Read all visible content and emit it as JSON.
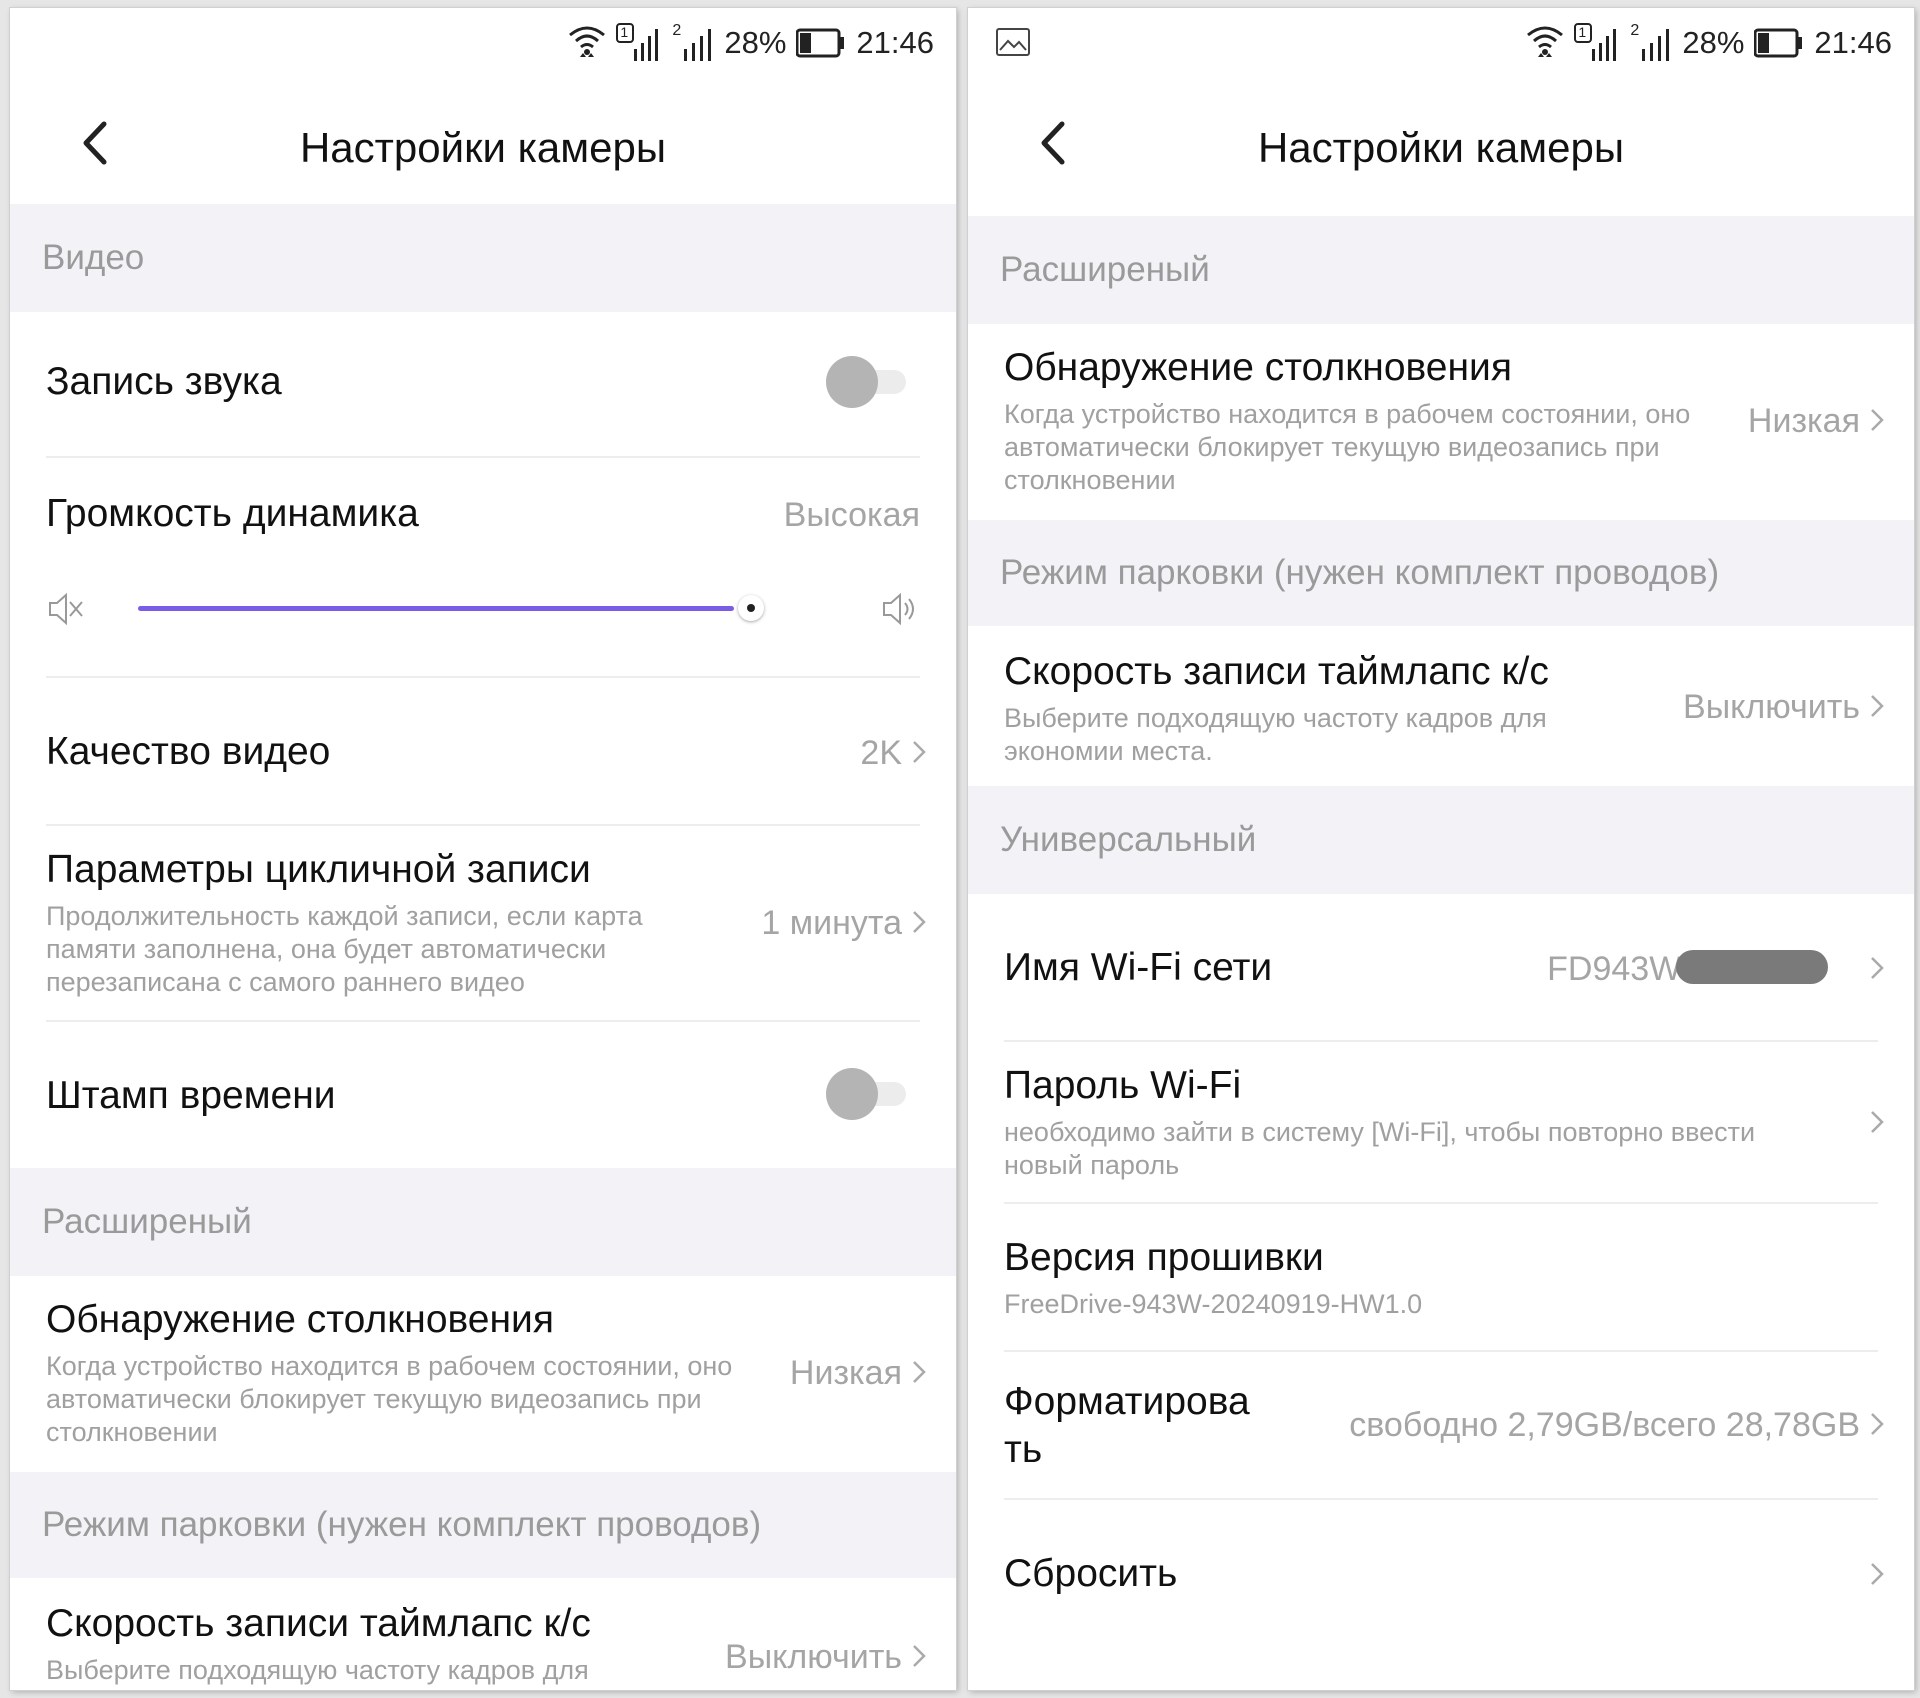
{
  "status_bar": {
    "sim1_label": "1",
    "sim2_label": "2",
    "battery_percent": "28%",
    "battery_level": 0.28,
    "time": "21:46"
  },
  "left": {
    "title": "Настройки камеры",
    "sections": {
      "video": "Видео",
      "advanced": "Расширеный",
      "parking": "Режим парковки (нужен комплект проводов)"
    },
    "sound_recording": {
      "label": "Запись звука",
      "enabled": false
    },
    "speaker_volume": {
      "label": "Громкость динамика",
      "value": "Высокая",
      "slider_level": 1.0
    },
    "video_quality": {
      "label": "Качество видео",
      "value": "2K"
    },
    "loop_recording": {
      "label": "Параметры цикличной записи",
      "desc": "Продолжительность каждой записи, если карта памяти заполнена, она будет автоматически перезаписана с самого раннего видео",
      "value": "1 минута"
    },
    "timestamp": {
      "label": "Штамп времени",
      "enabled": false
    },
    "collision": {
      "label": "Обнаружение столкновения",
      "desc": "Когда устройство находится в рабочем состоянии, оно автоматически блокирует текущую видеозапись при столкновении",
      "value": "Низкая"
    },
    "timelapse": {
      "label": "Скорость записи таймлапс к/с",
      "desc": "Выберите подходящую частоту кадров для",
      "value": "Выключить"
    }
  },
  "right": {
    "title": "Настройки камеры",
    "sections": {
      "advanced": "Расширеный",
      "parking": "Режим парковки (нужен комплект проводов)",
      "universal": "Универсальный"
    },
    "collision": {
      "label": "Обнаружение столкновения",
      "desc": "Когда устройство находится в рабочем состоянии, оно автоматически блокирует текущую видеозапись при столкновении",
      "value": "Низкая"
    },
    "timelapse": {
      "label": "Скорость записи таймлапс к/с",
      "desc": "Выберите подходящую частоту кадров для экономии места.",
      "value": "Выключить"
    },
    "wifi_name": {
      "label": "Имя Wi-Fi сети",
      "value": "FD943W-"
    },
    "wifi_password": {
      "label": "Пароль Wi-Fi",
      "desc": "необходимо зайти в систему [Wi-Fi], чтобы повторно ввести новый пароль"
    },
    "firmware": {
      "label": "Версия прошивки",
      "value": "FreeDrive-943W-20240919-HW1.0"
    },
    "format": {
      "label": "Форматирова ть",
      "value": "свободно 2,79GB/всего 28,78GB"
    },
    "reset": {
      "label": "Сбросить"
    }
  },
  "colors": {
    "accent": "#7b5ce6",
    "section_bg": "#f3f3f7",
    "muted_text": "#a0a0a0",
    "toggle_off": "#b4b4b4"
  },
  "icons": [
    "wifi-icon",
    "signal-icon",
    "battery-icon",
    "back-arrow-icon",
    "chevron-right-icon",
    "volume-mute-icon",
    "volume-up-icon",
    "image-icon"
  ]
}
